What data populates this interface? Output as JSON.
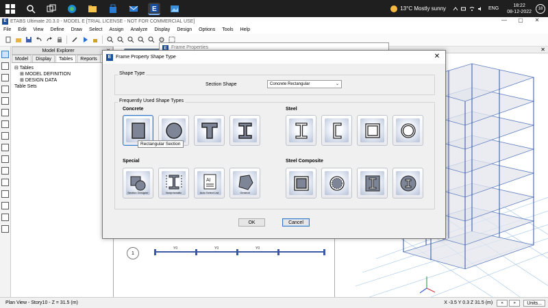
{
  "taskbar": {
    "weather": {
      "temp": "13°C",
      "condition": "Mostly sunny"
    },
    "language": "ENG",
    "clock": {
      "time": "18:22",
      "date": "08-12-2022"
    },
    "notification_count": "18"
  },
  "app": {
    "title": "ETABS Ultimate 20.3.0 - MODEL E  [TRIAL LICENSE - NOT FOR COMMERCIAL USE]",
    "logo": "E",
    "window_controls": [
      "—",
      "▢",
      "✕"
    ]
  },
  "menu": [
    "File",
    "Edit",
    "View",
    "Define",
    "Draw",
    "Select",
    "Assign",
    "Analyze",
    "Display",
    "Design",
    "Options",
    "Tools",
    "Help"
  ],
  "explorer": {
    "title": "Model Explorer",
    "tabs": [
      "Model",
      "Display",
      "Tables",
      "Reports"
    ],
    "tree": {
      "root": "Tables",
      "model_definition": "MODEL DEFINITION",
      "design_data": "DESIGN DATA",
      "table_sets": "Table Sets"
    }
  },
  "plan": {
    "grid_bubble": "1",
    "beam_labels": [
      "Y0",
      "Y0",
      "Y0"
    ]
  },
  "background_window": {
    "title": "Frame Properties"
  },
  "dialog": {
    "title": "Frame Property Shape Type",
    "shape_type_group": "Shape Type",
    "section_shape_label": "Section Shape",
    "section_shape_value": "Concrete Rectangular",
    "frequent_group": "Frequently Used Shape Types",
    "categories": {
      "concrete": "Concrete",
      "steel": "Steel",
      "special": "Special",
      "steel_composite": "Steel Composite"
    },
    "special_captions": [
      "Section Designer",
      "Nonprismatic",
      "Auto Select List",
      "General"
    ],
    "tooltip": "Rectangular Section",
    "ok": "OK",
    "cancel": "Cancel"
  },
  "status": {
    "left": "Plan View - Story10 - Z = 31.5 (m)",
    "coords": "X -3.5  Y 0.3  Z 31.5 (m)",
    "units": "Units..."
  }
}
